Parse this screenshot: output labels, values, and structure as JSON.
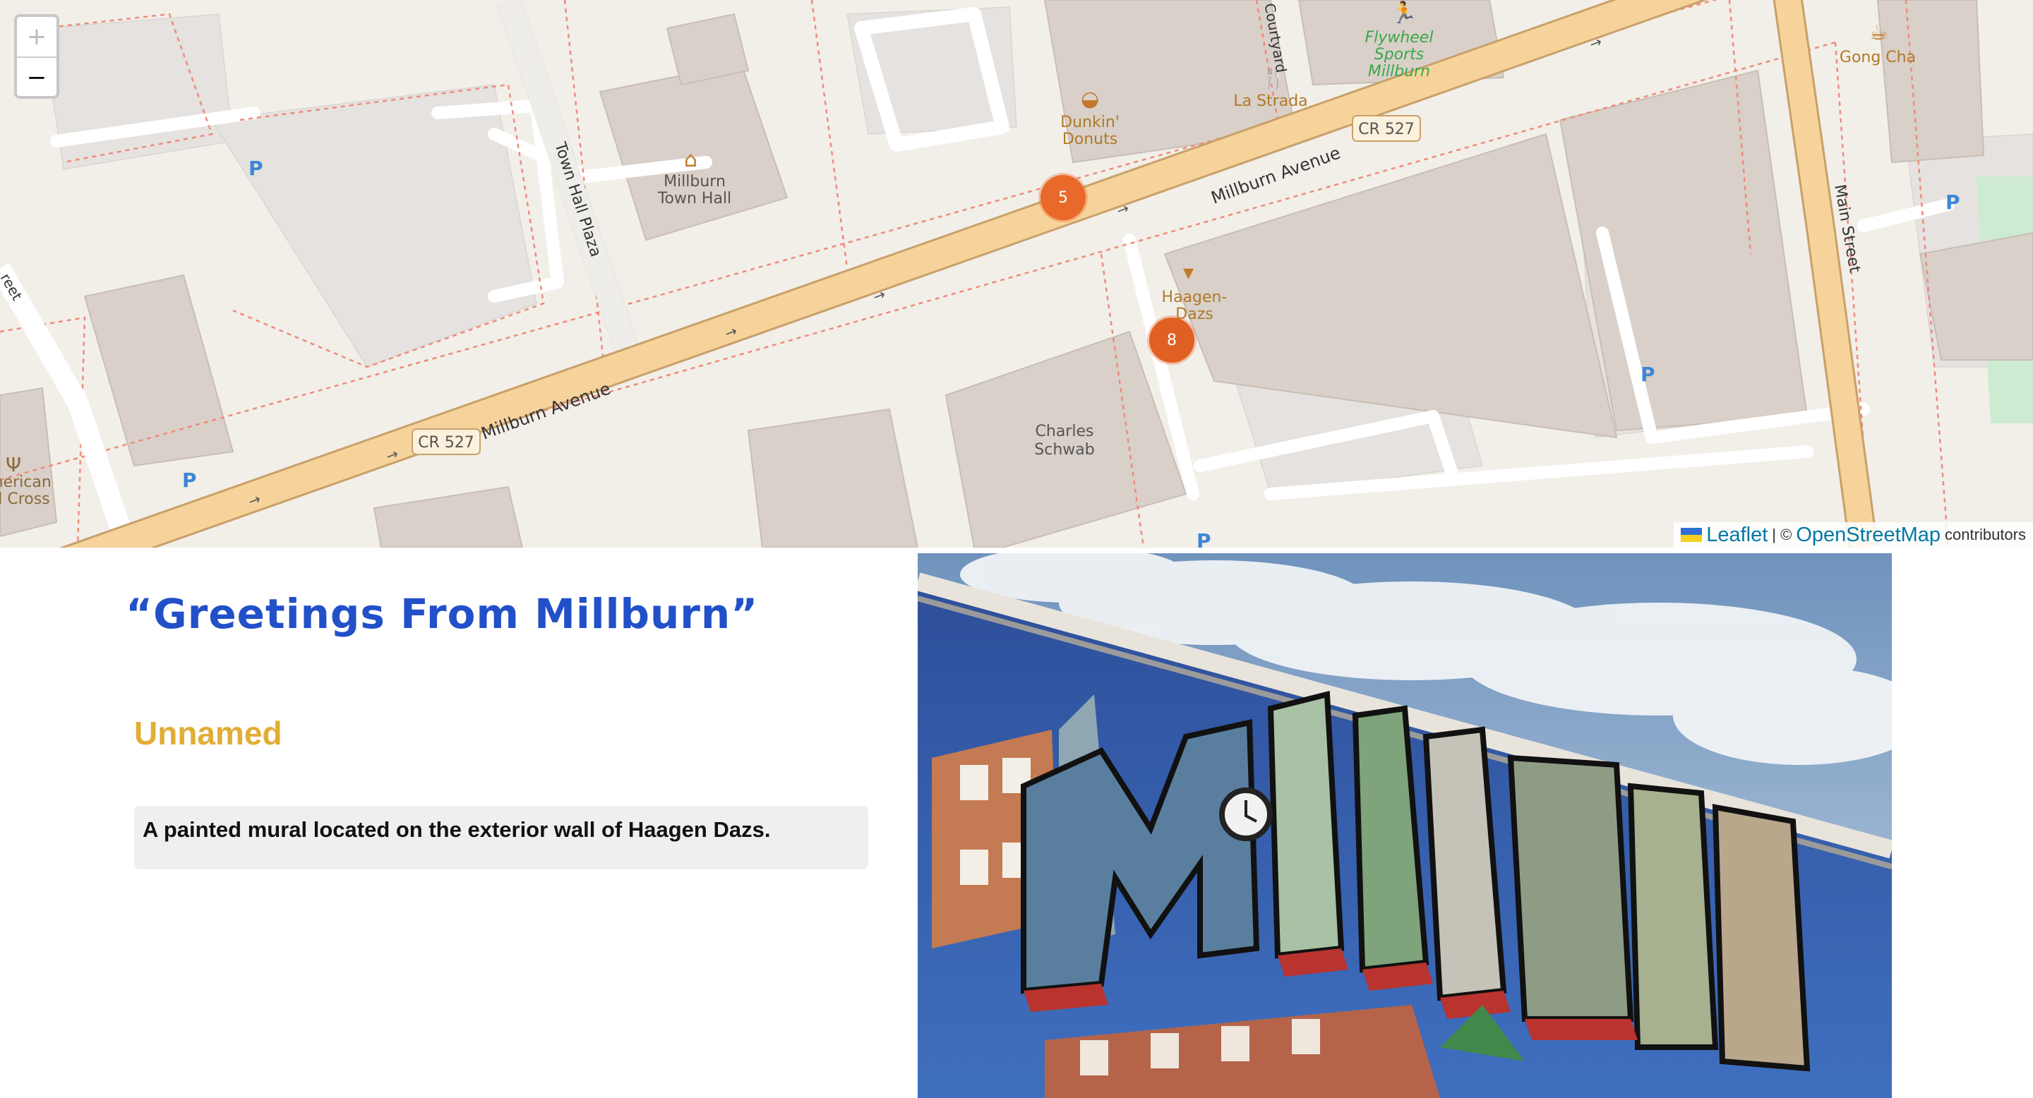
{
  "map": {
    "zoom_in": "+",
    "zoom_out": "−",
    "markers": [
      {
        "count": "5"
      },
      {
        "count": "8"
      }
    ],
    "labels": {
      "millburn_avenue": "Millburn Avenue",
      "cr527": "CR 527",
      "town_hall_plaza": "Town Hall Plaza",
      "main_street": "Main Street",
      "courtyard": "Courtyard",
      "millburn_town_hall_1": "Millburn",
      "millburn_town_hall_2": "Town Hall",
      "dunkin_1": "Dunkin'",
      "dunkin_2": "Donuts",
      "la_strada": "La Strada",
      "flywheel_1": "Flywheel",
      "flywheel_2": "Sports",
      "flywheel_3": "Millburn",
      "gong_cha": "Gong Cha",
      "haagen_1": "Haagen-",
      "haagen_2": "Dazs",
      "schwab_1": "Charles",
      "schwab_2": "Schwab",
      "red_cross_1": "merican",
      "red_cross_2": "d Cross",
      "street_left": "reet",
      "parking": "P"
    },
    "attribution": {
      "leaflet": "Leaflet",
      "separator": "| ©",
      "osm": "OpenStreetMap",
      "contributors": "contributors"
    }
  },
  "mural": {
    "title": "“Greetings From Millburn”",
    "artist": "Unnamed",
    "description": "A painted mural located on the exterior wall of Haagen Dazs.",
    "photo_lettering": "MILLBURN"
  },
  "colors": {
    "title": "#2250c9",
    "artist": "#e1ad34",
    "marker": "#e8692a",
    "road_primary": "#f7d39c",
    "building": "#d9d0c9",
    "map_background": "#f2efe9"
  }
}
